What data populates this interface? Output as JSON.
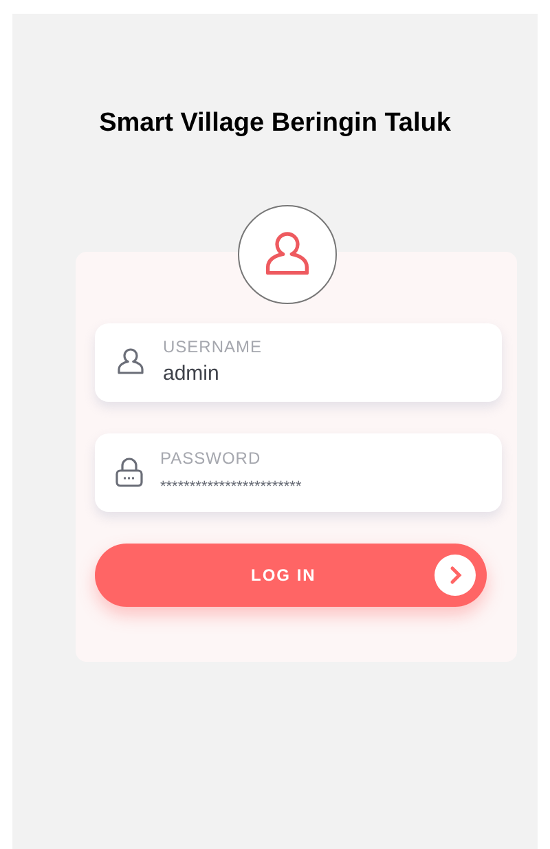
{
  "title": "Smart Village Beringin Taluk",
  "fields": [
    {
      "kind": "text",
      "label": "USERNAME",
      "value": "admin"
    },
    {
      "kind": "password",
      "label": "PASSWORD",
      "value": "************************"
    }
  ],
  "login_button": {
    "label": "LOG IN"
  }
}
